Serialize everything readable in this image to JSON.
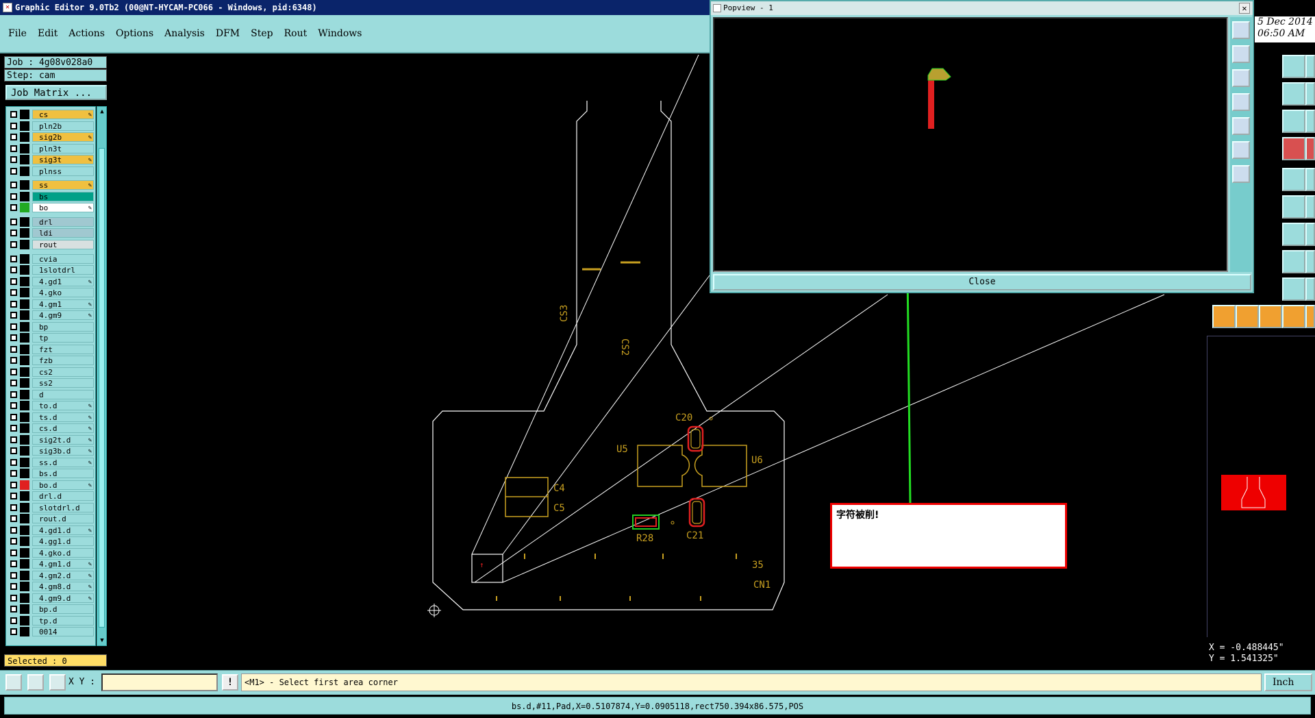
{
  "window": {
    "title": "Graphic Editor 9.0Tb2 (00@NT-HYCAM-PC066 - Windows, pid:6348)"
  },
  "menu": [
    "File",
    "Edit",
    "Actions",
    "Options",
    "Analysis",
    "DFM",
    "Step",
    "Rout",
    "Windows"
  ],
  "job": {
    "job_label": "Job : 4g08v028a0",
    "step_label": "Step: cam",
    "job_matrix_button": "Job Matrix ..."
  },
  "layers": [
    {
      "name": "cs",
      "color": "#f0c040",
      "editable": true
    },
    {
      "name": "pln2b",
      "color": "#9cdcdc",
      "editable": false
    },
    {
      "name": "sig2b",
      "color": "#f0c040",
      "editable": true
    },
    {
      "name": "pln3t",
      "color": "#9cdcdc",
      "editable": false
    },
    {
      "name": "sig3t",
      "color": "#f0c040",
      "editable": true
    },
    {
      "name": "plnss",
      "color": "#9cdcdc",
      "editable": false
    },
    {
      "name": "ss",
      "color": "#f0c040",
      "editable": true
    },
    {
      "name": "bs",
      "color": "#00a088",
      "editable": false
    },
    {
      "name": "bo",
      "color": "#ffffff",
      "editable": true,
      "swatch": "#22aa22"
    },
    {
      "name": "drl",
      "color": "#a0c8d0",
      "editable": false
    },
    {
      "name": "ldi",
      "color": "#a0c8d0",
      "editable": false
    },
    {
      "name": "rout",
      "color": "#d8e0e0",
      "editable": false
    },
    {
      "name": "cvia",
      "color": "#9cdcdc",
      "editable": false
    },
    {
      "name": "1slotdrl",
      "color": "#9cdcdc",
      "editable": false
    },
    {
      "name": "4.gd1",
      "color": "#9cdcdc",
      "editable": true
    },
    {
      "name": "4.gko",
      "color": "#9cdcdc",
      "editable": false
    },
    {
      "name": "4.gm1",
      "color": "#9cdcdc",
      "editable": true
    },
    {
      "name": "4.gm9",
      "color": "#9cdcdc",
      "editable": true
    },
    {
      "name": "bp",
      "color": "#9cdcdc",
      "editable": false
    },
    {
      "name": "tp",
      "color": "#9cdcdc",
      "editable": false
    },
    {
      "name": "fzt",
      "color": "#9cdcdc",
      "editable": false
    },
    {
      "name": "fzb",
      "color": "#9cdcdc",
      "editable": false
    },
    {
      "name": "cs2",
      "color": "#9cdcdc",
      "editable": false
    },
    {
      "name": "ss2",
      "color": "#9cdcdc",
      "editable": false
    },
    {
      "name": "d",
      "color": "#9cdcdc",
      "editable": false
    },
    {
      "name": "to.d",
      "color": "#9cdcdc",
      "editable": true
    },
    {
      "name": "ts.d",
      "color": "#9cdcdc",
      "editable": true
    },
    {
      "name": "cs.d",
      "color": "#9cdcdc",
      "editable": true
    },
    {
      "name": "sig2t.d",
      "color": "#9cdcdc",
      "editable": true
    },
    {
      "name": "sig3b.d",
      "color": "#9cdcdc",
      "editable": true
    },
    {
      "name": "ss.d",
      "color": "#9cdcdc",
      "editable": true
    },
    {
      "name": "bs.d",
      "color": "#9cdcdc",
      "editable": false
    },
    {
      "name": "bo.d",
      "color": "#9cdcdc",
      "editable": true,
      "swatch": "#e02020"
    },
    {
      "name": "drl.d",
      "color": "#9cdcdc",
      "editable": false
    },
    {
      "name": "slotdrl.d",
      "color": "#9cdcdc",
      "editable": false
    },
    {
      "name": "rout.d",
      "color": "#9cdcdc",
      "editable": false
    },
    {
      "name": "4.gd1.d",
      "color": "#9cdcdc",
      "editable": true
    },
    {
      "name": "4.gg1.d",
      "color": "#9cdcdc",
      "editable": false
    },
    {
      "name": "4.gko.d",
      "color": "#9cdcdc",
      "editable": false
    },
    {
      "name": "4.gm1.d",
      "color": "#9cdcdc",
      "editable": true
    },
    {
      "name": "4.gm2.d",
      "color": "#9cdcdc",
      "editable": true
    },
    {
      "name": "4.gm8.d",
      "color": "#9cdcdc",
      "editable": true
    },
    {
      "name": "4.gm9.d",
      "color": "#9cdcdc",
      "editable": true
    },
    {
      "name": "bp.d",
      "color": "#9cdcdc",
      "editable": false
    },
    {
      "name": "tp.d",
      "color": "#9cdcdc",
      "editable": false
    },
    {
      "name": "0014",
      "color": "#9cdcdc",
      "editable": false
    }
  ],
  "selected_label": "Selected : 0",
  "popview": {
    "title": "Popview - 1",
    "close_label": "Close"
  },
  "date": {
    "line1": "5 Dec 2014",
    "line2": "06:50 AM"
  },
  "canvas_labels": {
    "cs3": "CS3",
    "cs2": "CS2",
    "c20": "C20",
    "u5": "U5",
    "u6": "U6",
    "c4": "C4",
    "c5": "C5",
    "c21": "C21",
    "r28": "R28",
    "n35": "35",
    "cn1": "CN1"
  },
  "alert": {
    "text": "字符被削!"
  },
  "coords": {
    "x": "X = -0.488445\"",
    "y": "Y =  1.541325\""
  },
  "command": {
    "xy_label": "X Y :",
    "xy_value": "",
    "warn_symbol": "!",
    "prompt": "<M1> - Select first area corner",
    "units": "Inch"
  },
  "status": {
    "text": "bs.d,#11,Pad,X=0.5107874,Y=0.0905118,rect750.394x86.575,POS"
  },
  "colors": {
    "panel": "#9cdcdc",
    "outline": "#ffffff",
    "copper": "#c8a020",
    "highlight": "#e02020",
    "arrow": "#22dd22"
  }
}
